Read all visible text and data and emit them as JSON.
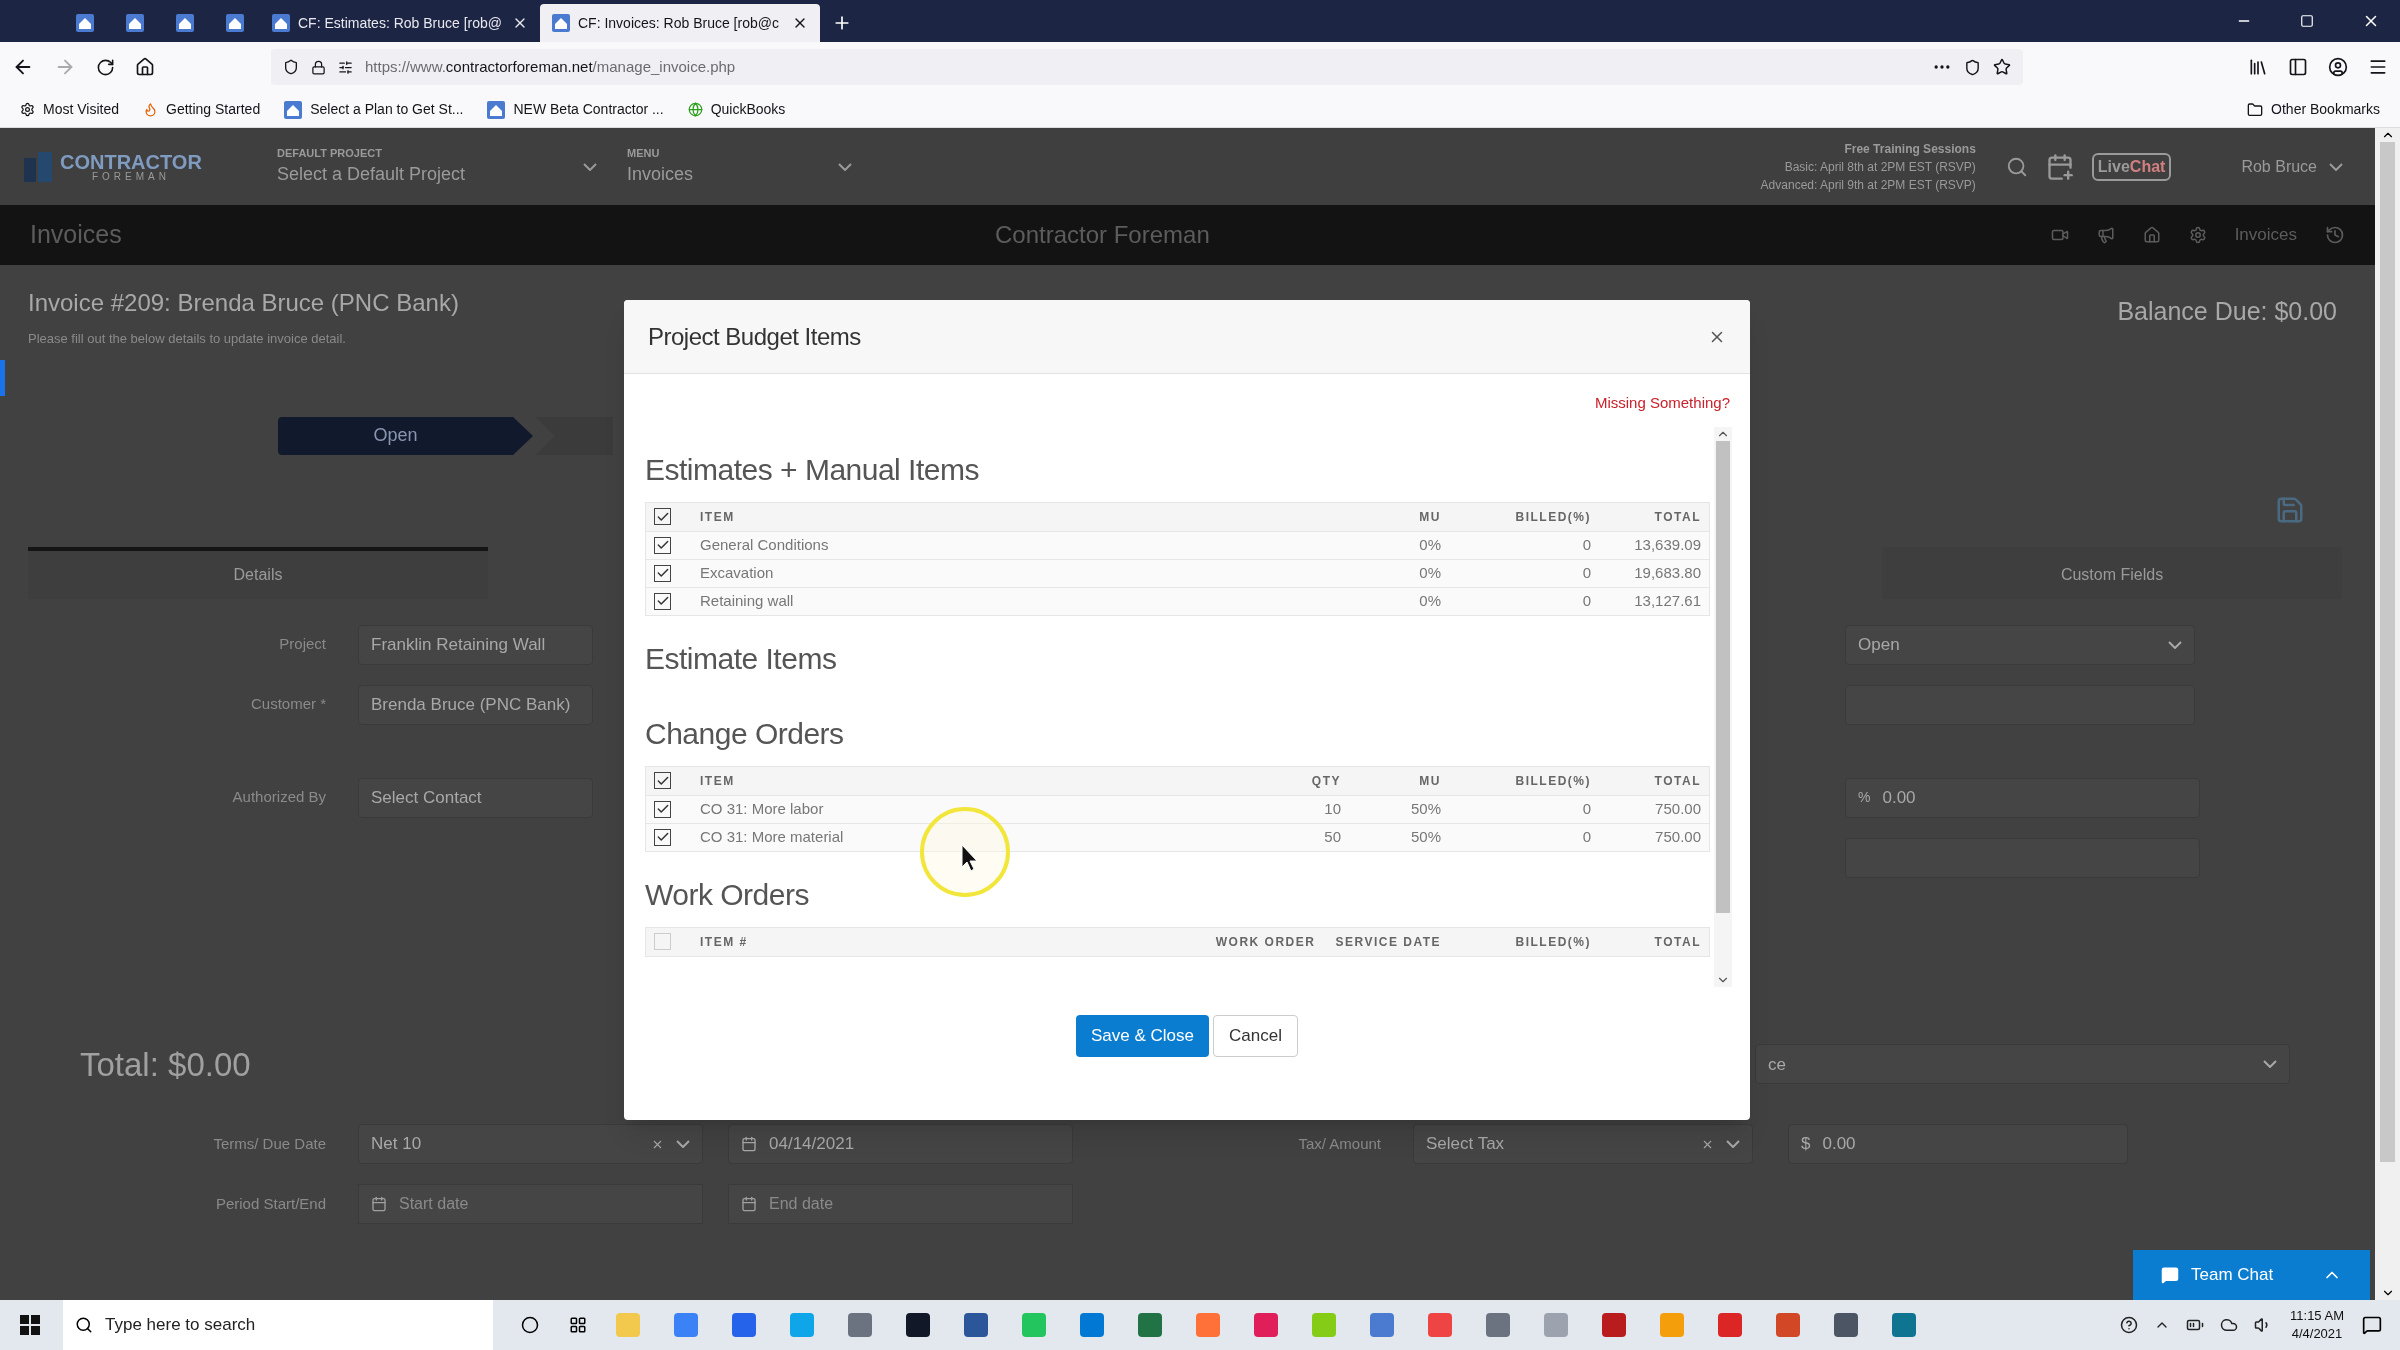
{
  "browser": {
    "tabs": [
      {
        "kind": "pinned",
        "selected": false
      },
      {
        "kind": "pinned",
        "selected": false
      },
      {
        "kind": "pinned",
        "selected": false
      },
      {
        "kind": "pinned",
        "selected": false
      },
      {
        "kind": "page",
        "label": "CF: Estimates: Rob Bruce [rob@",
        "selected": false
      },
      {
        "kind": "page",
        "label": "CF: Invoices: Rob Bruce [rob@c",
        "selected": true
      }
    ],
    "url": {
      "scheme": "https://www.",
      "domain": "contractorforeman.net",
      "path": "/manage_invoice.php"
    },
    "bookmarks": [
      "Most Visited",
      "Getting Started",
      "Select a Plan to Get St...",
      "NEW Beta Contractor ...",
      "QuickBooks"
    ],
    "other_bookmarks": "Other Bookmarks"
  },
  "app_header": {
    "logo": [
      "CONTRACTOR",
      "FOREMAN"
    ],
    "default_project": {
      "label": "DEFAULT PROJECT",
      "value": "Select a Default Project"
    },
    "menu": {
      "label": "MENU",
      "value": "Invoices"
    },
    "training": [
      "Free Training Sessions",
      "Basic: April 8th at 2PM EST (RSVP)",
      "Advanced: April 9th at 2PM EST (RSVP)"
    ],
    "livechat": [
      "Live",
      "Chat"
    ],
    "user": "Rob Bruce"
  },
  "page_bar": {
    "title": "Invoices",
    "center": "Contractor Foreman",
    "breadcrumb": "Invoices"
  },
  "invoice": {
    "title": "Invoice #209: Brenda Bruce (PNC Bank)",
    "subtitle": "Please fill out the below details to update invoice detail.",
    "balance": "Balance Due: $0.00",
    "steps": [
      {
        "label": "Open",
        "selected": true
      }
    ],
    "tabs": [
      {
        "label": "Details",
        "selected": true
      },
      {
        "label": "Custom Fields",
        "selected": false
      }
    ],
    "fields": [
      {
        "label": "Project",
        "value": "Franklin Retaining Wall"
      },
      {
        "label": "Customer *",
        "value": "Brenda Bruce (PNC Bank)"
      },
      {
        "label": "Authorized By",
        "value": "Select Contact"
      }
    ],
    "status_value": "Open",
    "percent_symbol": "%",
    "percent_value": "0.00",
    "partial_select": "ce",
    "total": "Total: $0.00",
    "terms": {
      "label": "Terms/ Due Date",
      "value": "Net 10",
      "date": "04/14/2021"
    },
    "tax": {
      "label": "Tax/ Amount",
      "value": "Select Tax",
      "currency": "$",
      "amount": "0.00"
    },
    "period": {
      "label": "Period Start/End",
      "start_placeholder": "Start date",
      "end_placeholder": "End date"
    }
  },
  "modal": {
    "title": "Project Budget Items",
    "missing_link": "Missing Something?",
    "sections": [
      {
        "title": "Estimates + Manual Items",
        "all_checked": true,
        "columns": [
          "ITEM",
          "MU",
          "BILLED(%)",
          "TOTAL"
        ],
        "rows": [
          {
            "checked": true,
            "cells": [
              "General Conditions",
              "0%",
              "0",
              "13,639.09"
            ]
          },
          {
            "checked": true,
            "cells": [
              "Excavation",
              "0%",
              "0",
              "19,683.80"
            ]
          },
          {
            "checked": true,
            "cells": [
              "Retaining wall",
              "0%",
              "0",
              "13,127.61"
            ]
          }
        ]
      },
      {
        "title": "Estimate Items"
      },
      {
        "title": "Change Orders",
        "all_checked": true,
        "columns": [
          "ITEM",
          "QTY",
          "MU",
          "BILLED(%)",
          "TOTAL"
        ],
        "rows": [
          {
            "checked": true,
            "cells": [
              "CO 31: More labor",
              "10",
              "50%",
              "0",
              "750.00"
            ]
          },
          {
            "checked": true,
            "cells": [
              "CO 31: More material",
              "50",
              "50%",
              "0",
              "750.00"
            ]
          }
        ]
      },
      {
        "title": "Work Orders",
        "all_checked": false,
        "columns": [
          "ITEM #",
          "WORK ORDER",
          "SERVICE DATE",
          "BILLED(%)",
          "TOTAL"
        ]
      }
    ],
    "buttons": [
      {
        "kind": "primary",
        "label": "Save & Close"
      },
      {
        "kind": "secondary",
        "label": "Cancel"
      }
    ]
  },
  "team_chat": "Team Chat",
  "taskbar": {
    "search_placeholder": "Type here to search",
    "time": "11:15 AM",
    "date": "4/4/2021"
  }
}
